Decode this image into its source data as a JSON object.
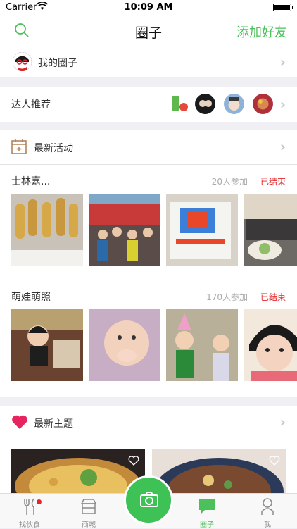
{
  "statusbar": {
    "carrier": "Carrier",
    "time": "10:09 AM"
  },
  "navbar": {
    "title": "圈子",
    "add_friend": "添加好友"
  },
  "my_circle": {
    "label": "我的圈子"
  },
  "recommend": {
    "label": "达人推荐"
  },
  "activities": {
    "title": "最新活动",
    "items": [
      {
        "name": "士林嘉...",
        "count": "20人参加",
        "status": "已结束"
      },
      {
        "name": "萌娃萌照",
        "count": "170人参加",
        "status": "已结束"
      }
    ]
  },
  "topics": {
    "title": "最新主题"
  },
  "tabbar": {
    "items": [
      {
        "label": "找伙食"
      },
      {
        "label": "商城"
      },
      {
        "label": "圈子"
      },
      {
        "label": "我"
      }
    ]
  },
  "colors": {
    "accent": "#4cc05a",
    "alert": "#e2262a",
    "heart": "#e6245f"
  }
}
